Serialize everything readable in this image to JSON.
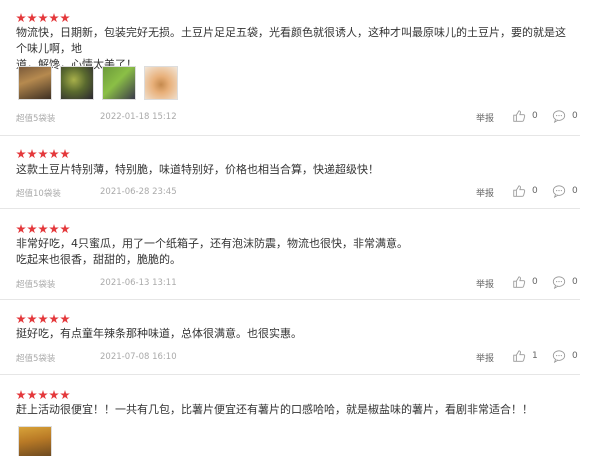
{
  "reviews": [
    {
      "rating": 5,
      "lines": [
        "物流快，日期新，包装完好无损。土豆片足足五袋，光看颜色就很诱人，这种才叫最原味儿的土豆片，要的就是这个味儿啊，地",
        "道，解馋，心情太美了！"
      ],
      "tag": "超值5袋装",
      "date": "2022-01-18 15:12",
      "report": "举报",
      "likes": "0",
      "comments": "0",
      "photos": 4
    },
    {
      "rating": 5,
      "lines": [
        "这款土豆片特别薄，特别脆，味道特别好，价格也相当合算，快递超级快！"
      ],
      "tag": "超值10袋装",
      "date": "2021-06-28 23:45",
      "report": "举报",
      "likes": "0",
      "comments": "0",
      "photos": 0
    },
    {
      "rating": 5,
      "lines": [
        "非常好吃，4只蜜瓜，用了一个纸箱子，还有泡沫防震，物流也很快，非常满意。",
        "吃起来也很香，甜甜的，脆脆的。"
      ],
      "tag": "超值5袋装",
      "date": "2021-06-13 13:11",
      "report": "举报",
      "likes": "0",
      "comments": "0",
      "photos": 0
    },
    {
      "rating": 5,
      "lines": [
        "挺好吃，有点童年辣条那种味道，总体很满意。也很实惠。"
      ],
      "tag": "超值5袋装",
      "date": "2021-07-08 16:10",
      "report": "举报",
      "likes": "1",
      "comments": "0",
      "photos": 0
    },
    {
      "rating": 5,
      "lines": [
        "赶上活动很便宜！！一共有几包，比薯片便宜还有薯片的口感哈哈，就是椒盐味的薯片，看剧非常适合！！"
      ],
      "photos": 1
    }
  ],
  "colors": {
    "star": "#e4393c",
    "divider": "#e6e6e6"
  }
}
